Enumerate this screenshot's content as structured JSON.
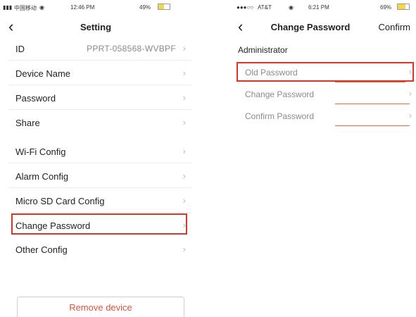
{
  "left": {
    "status": {
      "carrier": "中国移动",
      "time": "12:46 PM",
      "battery": "49%"
    },
    "nav": {
      "title": "Setting"
    },
    "rows": [
      {
        "label": "ID",
        "value": "PPRT-058568-WVBPF"
      },
      {
        "label": "Device Name"
      },
      {
        "label": "Password"
      },
      {
        "label": "Share"
      },
      {
        "label": "Wi-Fi Config"
      },
      {
        "label": "Alarm Config"
      },
      {
        "label": "Micro SD Card Config"
      },
      {
        "label": "Change Password"
      },
      {
        "label": "Other Config"
      }
    ],
    "remove_label": "Remove device"
  },
  "right": {
    "status": {
      "carrier": "AT&T",
      "time": "6:21 PM",
      "battery": "69%"
    },
    "nav": {
      "title": "Change Password",
      "confirm": "Confirm"
    },
    "section": "Administrator",
    "fields": [
      {
        "label": "Old Password"
      },
      {
        "label": "Change Password"
      },
      {
        "label": "Confirm Password"
      }
    ]
  },
  "chevron": "›",
  "back": "‹",
  "colors": {
    "highlight": "#d9362b",
    "remove_text": "#e0533b",
    "underline": "#e36a45"
  }
}
